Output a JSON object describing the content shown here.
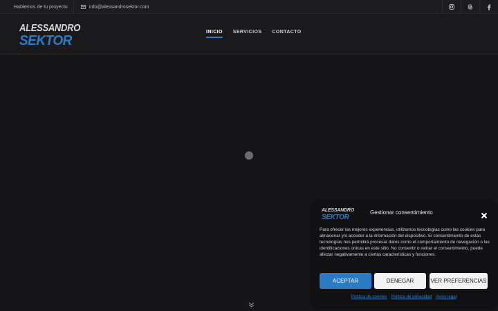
{
  "topbar": {
    "tagline": "Hablemos de tu proyecto",
    "email": "info@alessandrosektor.com",
    "social_icons": [
      "instagram-icon",
      "threads-icon",
      "facebook-icon"
    ]
  },
  "header": {
    "logo_line1": "ALESSANDRO",
    "logo_line2": "SEKTOR",
    "nav": [
      {
        "label": "INICIO",
        "active": true
      },
      {
        "label": "SERVICIOS",
        "active": false
      },
      {
        "label": "CONTACTO",
        "active": false
      }
    ]
  },
  "hero": {
    "loader_icon": "loading-dot",
    "scroll_icon": "chevron-double-down-icon"
  },
  "cookie_dialog": {
    "logo_line1": "ALESSANDRO",
    "logo_line2": "SEKTOR",
    "title": "Gestionar consentimiento",
    "body": "Para ofrecer las mejores experiencias, utilizamos tecnologías como las cookies para almacenar y/o acceder a la información del dispositivo. El consentimiento de estas tecnologías nos permitirá procesar datos como el comportamiento de navegación o las identificaciones únicas en este sitio. No consentir o retirar el consentimiento, puede afectar negativamente a ciertas características y funciones.",
    "accept_label": "ACEPTAR",
    "deny_label": "DENEGAR",
    "prefs_label": "VER PREFERENCIAS",
    "links": [
      "Política de cookies",
      "Política de privacidad",
      "Aviso legal"
    ]
  },
  "colors": {
    "accent": "#2b7bc4",
    "background": "#161618"
  }
}
